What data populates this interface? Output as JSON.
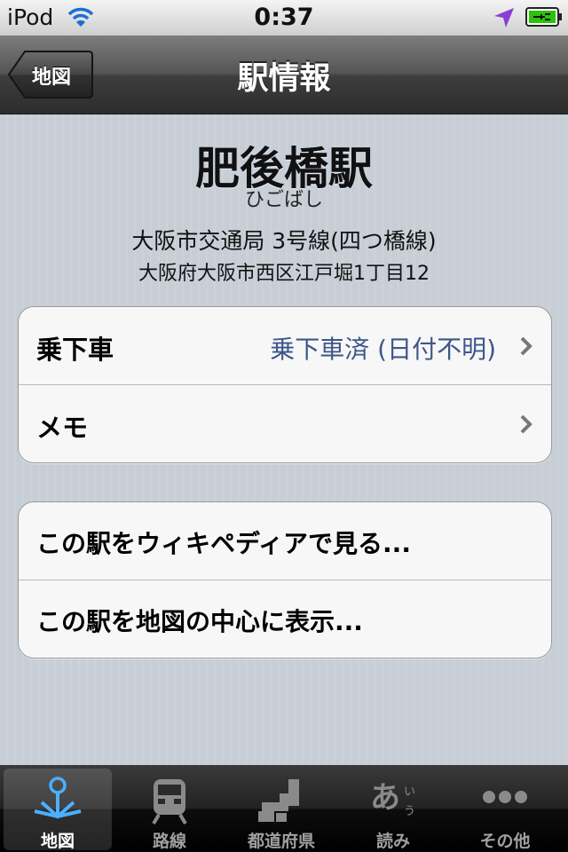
{
  "status_bar": {
    "device": "iPod",
    "time": "0:37",
    "wifi_icon": "wifi-icon",
    "location_icon": "location-arrow-icon",
    "battery_icon": "battery-charging-icon",
    "accent_color": "#8a3fd6",
    "battery_color": "#2bc40a"
  },
  "nav": {
    "back_label": "地図",
    "title": "駅情報"
  },
  "station": {
    "name": "肥後橋駅",
    "reading": "ひごばし",
    "line": "大阪市交通局 3号線(四つ橋線)",
    "address": "大阪府大阪市西区江戸堀1丁目12"
  },
  "details": [
    {
      "label": "乗下車",
      "value": "乗下車済 (日付不明)"
    },
    {
      "label": "メモ",
      "value": ""
    }
  ],
  "actions": [
    {
      "label": "この駅をウィキペディアで見る..."
    },
    {
      "label": "この駅を地図の中心に表示..."
    }
  ],
  "tabs": [
    {
      "label": "地図",
      "icon": "map-pin-icon",
      "selected": true
    },
    {
      "label": "路線",
      "icon": "train-icon",
      "selected": false
    },
    {
      "label": "都道府県",
      "icon": "prefecture-icon",
      "selected": false
    },
    {
      "label": "読み",
      "icon": "reading-icon",
      "selected": false
    },
    {
      "label": "その他",
      "icon": "more-icon",
      "selected": false
    }
  ]
}
